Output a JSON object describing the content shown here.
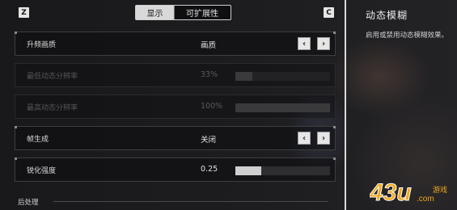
{
  "top_bar": {
    "left_key": "Z",
    "right_key": "C",
    "tabs": [
      {
        "label": "显示",
        "active": true
      },
      {
        "label": "可扩展性",
        "active": false
      }
    ]
  },
  "settings": [
    {
      "label": "升频画质",
      "value": "画质",
      "control": "arrows",
      "disabled": false
    },
    {
      "label": "最低动态分辨率",
      "value": "33%",
      "control": "bar",
      "level": 0.18,
      "disabled": true
    },
    {
      "label": "最高动态分辨率",
      "value": "100%",
      "control": "bar",
      "level": 1.0,
      "disabled": true
    },
    {
      "label": "帧生成",
      "value": "关闭",
      "control": "arrows",
      "disabled": false
    },
    {
      "label": "锐化强度",
      "value": "0.25",
      "control": "bar",
      "level": 0.27,
      "disabled": false
    }
  ],
  "section_header": "后处理",
  "side_panel": {
    "title": "动态模糊",
    "description": "启用或禁用动态模糊效果。"
  },
  "icons": {
    "prev": "chevron-left-icon",
    "next": "chevron-right-icon",
    "prev_glyph": "‹",
    "next_glyph": "›"
  },
  "watermark": {
    "brand": "43u",
    "domain": ".com",
    "suffix": "游戏",
    "color": "#f0a81c"
  }
}
